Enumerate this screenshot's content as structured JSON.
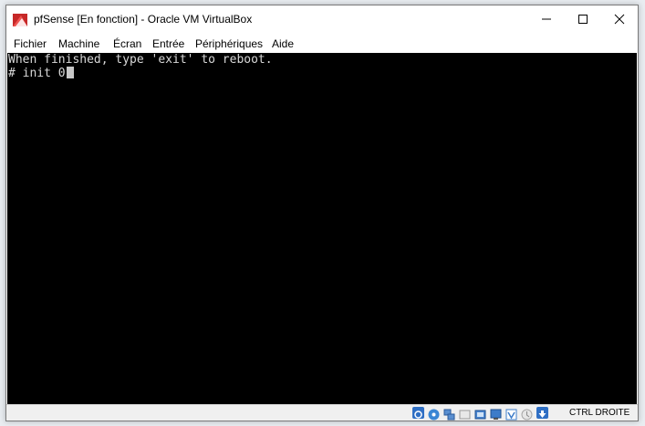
{
  "window": {
    "title": "pfSense [En fonction] - Oracle VM VirtualBox"
  },
  "menu": {
    "items": [
      "Fichier",
      "Machine",
      "Écran",
      "Entrée",
      "Périphériques",
      "Aide"
    ]
  },
  "console": {
    "lines": [
      "When finished, type 'exit' to reboot.",
      "# init 0"
    ],
    "background": "#000000",
    "text_color": "#d8d8d8"
  },
  "statusbar": {
    "icons": [
      "hard-disk-icon",
      "optical-drive-icon",
      "network-icon",
      "usb-icon",
      "shared-folders-icon",
      "display-icon",
      "video-capture-icon",
      "mouse-integration-icon",
      "keyboard-capture-icon"
    ],
    "host_key_label": "CTRL DROITE"
  }
}
